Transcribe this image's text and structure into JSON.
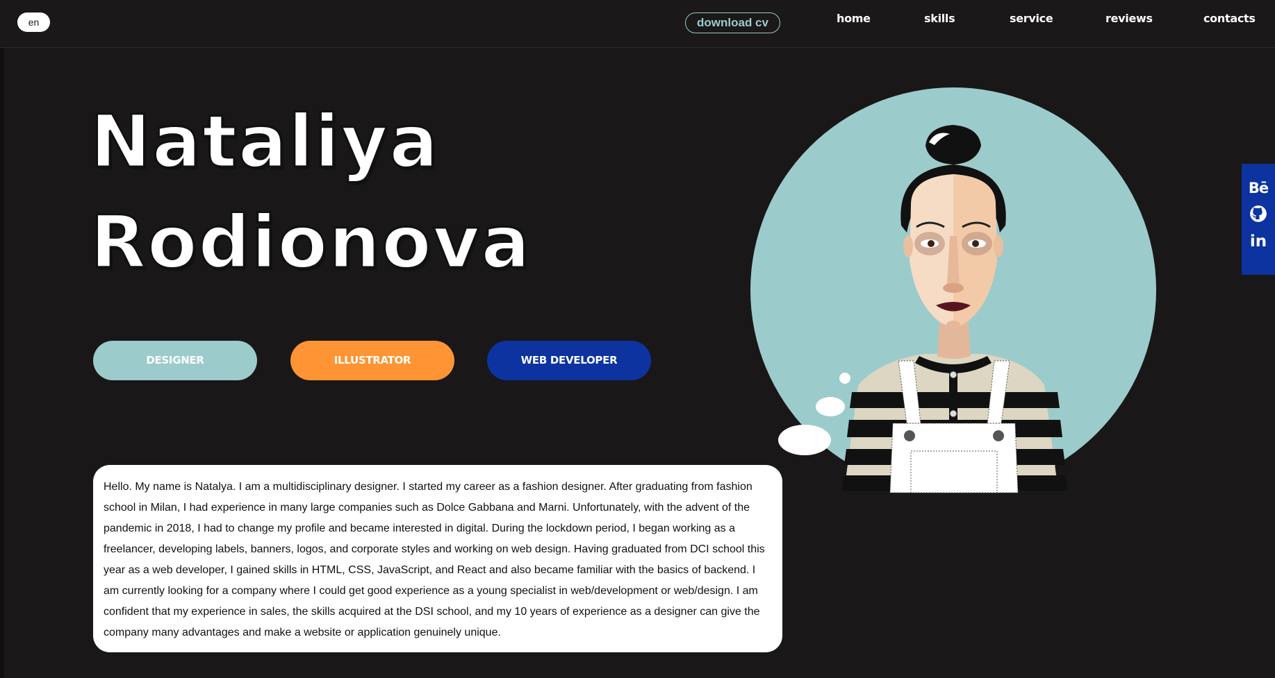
{
  "header": {
    "language": "en",
    "download_cv": "download cv",
    "nav": [
      "home",
      "skills",
      "service",
      "reviews",
      "contacts"
    ]
  },
  "hero": {
    "first_name": "Nataliya",
    "last_name": "Rodionova"
  },
  "roles": [
    {
      "label": "DESIGNER",
      "color": "#9ccbcb"
    },
    {
      "label": "ILLUSTRATOR",
      "color": "#fe9433"
    },
    {
      "label": "WEB DEVELOPER",
      "color": "#0c33a0"
    }
  ],
  "bio": {
    "text": "Hello. My name is Natalya. I am a multidisciplinary designer. I started my career as a fashion designer. After graduating from fashion school in Milan, I had experience in many large companies such as Dolce Gabbana and Marni. Unfortunately, with the advent of the pandemic in 2018, I had to change my profile and became interested in digital. During the lockdown period, I began working as a freelancer, developing labels, banners, logos, and corporate styles and working on web design. Having graduated from DCI school this year as a web developer, I gained skills in HTML, CSS, JavaScript, and React and also became familiar with the basics of backend. I am currently looking for a company where I could get good experience as a young specialist in web/development or web/design. I am confident that my experience in sales, the skills acquired at the DSI school, and my 10 years of experience as a designer can give the company many advantages and make a website or application genuinely unique."
  },
  "social": {
    "behance": "Bē",
    "linkedin": "in",
    "icons": [
      "behance-icon",
      "github-icon",
      "linkedin-icon"
    ]
  },
  "colors": {
    "background": "#191718",
    "accent_teal": "#9ccbcb",
    "accent_orange": "#fe9433",
    "accent_blue": "#0c33a0"
  }
}
